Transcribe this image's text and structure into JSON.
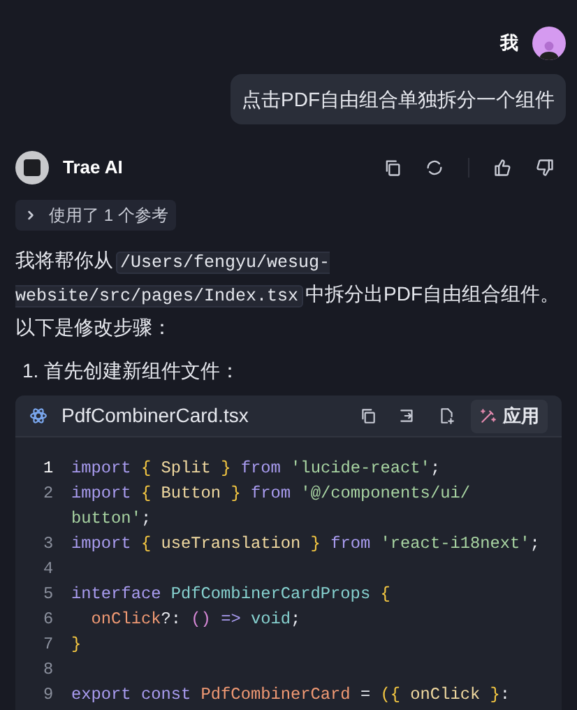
{
  "user_message": {
    "name": "我",
    "text": "点击PDF自由组合单独拆分一个组件"
  },
  "assistant": {
    "name": "Trae AI",
    "references": {
      "label": "使用了 1 个参考",
      "expanded": false
    }
  },
  "answer": {
    "parts": [
      {
        "kind": "text",
        "text": "我将帮你从"
      },
      {
        "kind": "code",
        "text": "/Users/fengyu/wesug-website/src/pages/Index.tsx"
      },
      {
        "kind": "text",
        "text": "中拆分出PDF自由组合组件。以下是修改步骤："
      }
    ],
    "steps": [
      {
        "number": "1.",
        "text": "首先创建新组件文件："
      }
    ]
  },
  "code_block": {
    "filename": "PdfCombinerCard.tsx",
    "apply_label": "应用",
    "lines": [
      {
        "number": "1",
        "current": true,
        "tokens": [
          {
            "kind": "keyword",
            "text": "import"
          },
          {
            "kind": "brace",
            "text": " { "
          },
          {
            "kind": "name",
            "text": "Split"
          },
          {
            "kind": "brace",
            "text": " } "
          },
          {
            "kind": "keyword",
            "text": "from"
          },
          {
            "kind": "string",
            "text": " 'lucide-react'"
          },
          {
            "kind": "plain",
            "text": ";"
          }
        ]
      },
      {
        "number": "2",
        "current": false,
        "tokens": [
          {
            "kind": "keyword",
            "text": "import"
          },
          {
            "kind": "brace",
            "text": " { "
          },
          {
            "kind": "name",
            "text": "Button"
          },
          {
            "kind": "brace",
            "text": " } "
          },
          {
            "kind": "keyword",
            "text": "from"
          },
          {
            "kind": "string",
            "text": " '@/components/ui/"
          },
          {
            "kind": "string",
            "text": "button'"
          },
          {
            "kind": "plain",
            "text": ";"
          }
        ]
      },
      {
        "number": "3",
        "current": false,
        "tokens": [
          {
            "kind": "keyword",
            "text": "import"
          },
          {
            "kind": "brace",
            "text": " { "
          },
          {
            "kind": "name",
            "text": "useTranslation"
          },
          {
            "kind": "brace",
            "text": " } "
          },
          {
            "kind": "keyword",
            "text": "from"
          },
          {
            "kind": "string",
            "text": " 'react-i18next'"
          },
          {
            "kind": "plain",
            "text": ";"
          }
        ]
      },
      {
        "number": "4",
        "current": false
      },
      {
        "number": "5",
        "current": false,
        "tokens": [
          {
            "kind": "keyword",
            "text": "interface"
          },
          {
            "kind": "type",
            "text": " PdfCombinerCardProps"
          },
          {
            "kind": "brace",
            "text": " {"
          }
        ]
      },
      {
        "number": "6",
        "current": false,
        "tokens": [
          {
            "kind": "prop",
            "text": "  onClick"
          },
          {
            "kind": "plain",
            "text": "?: "
          },
          {
            "kind": "paren",
            "text": "()"
          },
          {
            "kind": "keyword",
            "text": " =>"
          },
          {
            "kind": "type",
            "text": " void"
          },
          {
            "kind": "plain",
            "text": ";"
          }
        ]
      },
      {
        "number": "7",
        "current": false,
        "tokens": [
          {
            "kind": "brace",
            "text": "}"
          }
        ]
      },
      {
        "number": "8",
        "current": false
      },
      {
        "number": "9",
        "current": false,
        "tokens": [
          {
            "kind": "keyword",
            "text": "export const"
          },
          {
            "kind": "prop",
            "text": " PdfCombinerCard"
          },
          {
            "kind": "plain",
            "text": " = "
          },
          {
            "kind": "brace",
            "text": "({ "
          },
          {
            "kind": "name",
            "text": "onClick"
          },
          {
            "kind": "brace",
            "text": " }"
          },
          {
            "kind": "plain",
            "text": ":"
          }
        ]
      }
    ]
  }
}
